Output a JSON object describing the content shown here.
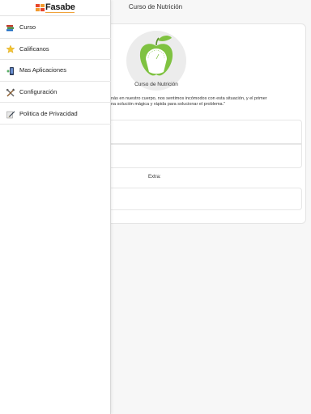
{
  "page": {
    "title": "Curso de Nutrición"
  },
  "card": {
    "logo_caption": "Curso de Nutrición",
    "description_line1": "nás en nuestro cuerpo, nos sentimos incómodos con esta situación, y el primer",
    "description_line2": "na solución mágica y rápida para solucionar el problema.\"",
    "extra_label": "Extra:"
  },
  "drawer": {
    "brand": "Fasabe",
    "items": [
      {
        "label": "Curso",
        "icon": "books-icon"
      },
      {
        "label": "Calificanos",
        "icon": "star-icon"
      },
      {
        "label": "Mas Aplicaciones",
        "icon": "add-app-icon"
      },
      {
        "label": "Configuración",
        "icon": "tools-icon"
      },
      {
        "label": "Politica de Privacidad",
        "icon": "policy-pen-icon"
      }
    ]
  },
  "colors": {
    "accent_green": "#7fc241",
    "brand_red": "#e8452a",
    "brand_orange": "#f29a2e"
  }
}
